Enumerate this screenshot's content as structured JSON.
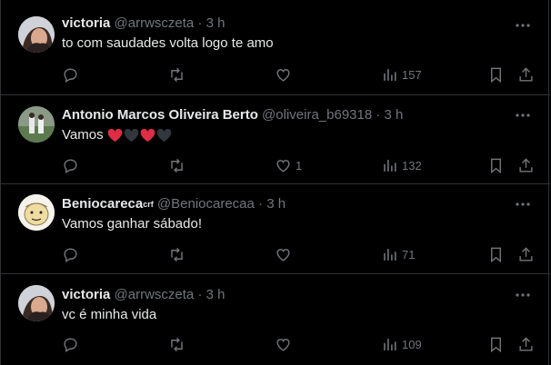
{
  "tweets": [
    {
      "name": "victoria",
      "handle": "@arrwsczeta",
      "time": "3 h",
      "text": "to com saudades volta logo te amo",
      "likes": "",
      "views": "157",
      "avatar": "user-photo"
    },
    {
      "name": "Antonio Marcos Oliveira Berto",
      "handle": "@oliveira_b69318",
      "time": "3 h",
      "text": "Vamos",
      "emojis": [
        "red-heart",
        "black-heart",
        "red-heart",
        "black-heart"
      ],
      "likes": "1",
      "views": "132",
      "avatar": "user-photo"
    },
    {
      "name": "Beniocareca",
      "name_sup": "crf",
      "handle": "@Beniocarecaa",
      "time": "3 h",
      "text": "Vamos ganhar sábado!",
      "likes": "",
      "views": "71",
      "avatar": "cartoon-face"
    },
    {
      "name": "victoria",
      "handle": "@arrwsczeta",
      "time": "3 h",
      "text": "vc é minha vida",
      "likes": "",
      "views": "109",
      "avatar": "user-photo"
    }
  ],
  "dot": "·",
  "colors": {
    "background": "#000000",
    "text": "#e7e9ea",
    "muted": "#71767b",
    "border": "#2f3336",
    "red_heart": "#dd2e44",
    "black_heart": "#31373d"
  },
  "icons": [
    "reply-icon",
    "retweet-icon",
    "like-icon",
    "views-icon",
    "bookmark-icon",
    "share-icon",
    "more-icon"
  ]
}
